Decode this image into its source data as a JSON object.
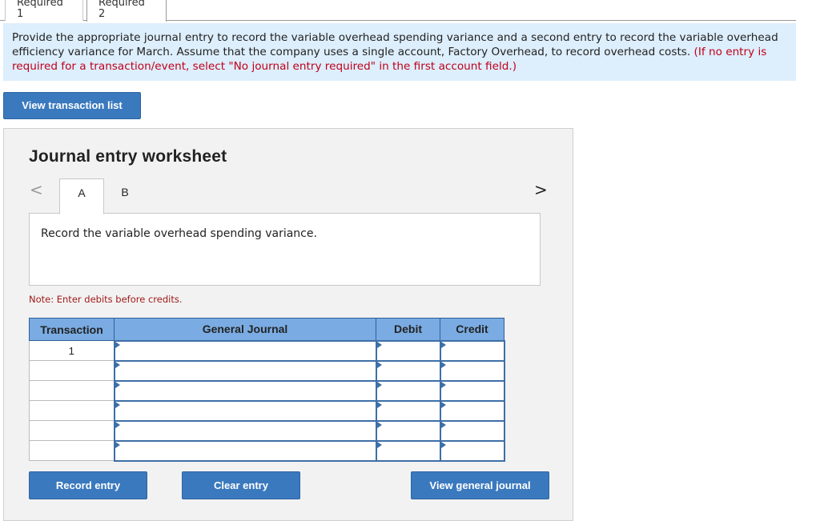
{
  "top_tabs": [
    "Required 1",
    "Required 2"
  ],
  "instructions": {
    "main": "Provide the appropriate journal entry to record the variable overhead spending variance and a second entry to record the variable overhead efficiency variance for March. Assume that the company uses a single account, Factory Overhead, to record overhead costs.",
    "note": "(If no entry is required for a transaction/event, select \"No journal entry required\" in the first account field.)"
  },
  "buttons": {
    "view_transaction_list": "View transaction list",
    "record_entry": "Record entry",
    "clear_entry": "Clear entry",
    "view_general_journal": "View general journal"
  },
  "worksheet": {
    "title": "Journal entry worksheet",
    "nav_prev": "<",
    "nav_next": ">",
    "tabs": [
      "A",
      "B"
    ],
    "description": "Record the variable overhead spending variance.",
    "note": "Note: Enter debits before credits."
  },
  "table": {
    "headers": [
      "Transaction",
      "General Journal",
      "Debit",
      "Credit"
    ],
    "rows": [
      {
        "transaction": "1",
        "account": "",
        "debit": "",
        "credit": ""
      },
      {
        "transaction": "",
        "account": "",
        "debit": "",
        "credit": ""
      },
      {
        "transaction": "",
        "account": "",
        "debit": "",
        "credit": ""
      },
      {
        "transaction": "",
        "account": "",
        "debit": "",
        "credit": ""
      },
      {
        "transaction": "",
        "account": "",
        "debit": "",
        "credit": ""
      },
      {
        "transaction": "",
        "account": "",
        "debit": "",
        "credit": ""
      }
    ]
  },
  "colors": {
    "instruction_bg": "#ddeefc",
    "button_blue": "#3a79be",
    "table_header": "#7aace3",
    "note_red": "#c0001a"
  }
}
